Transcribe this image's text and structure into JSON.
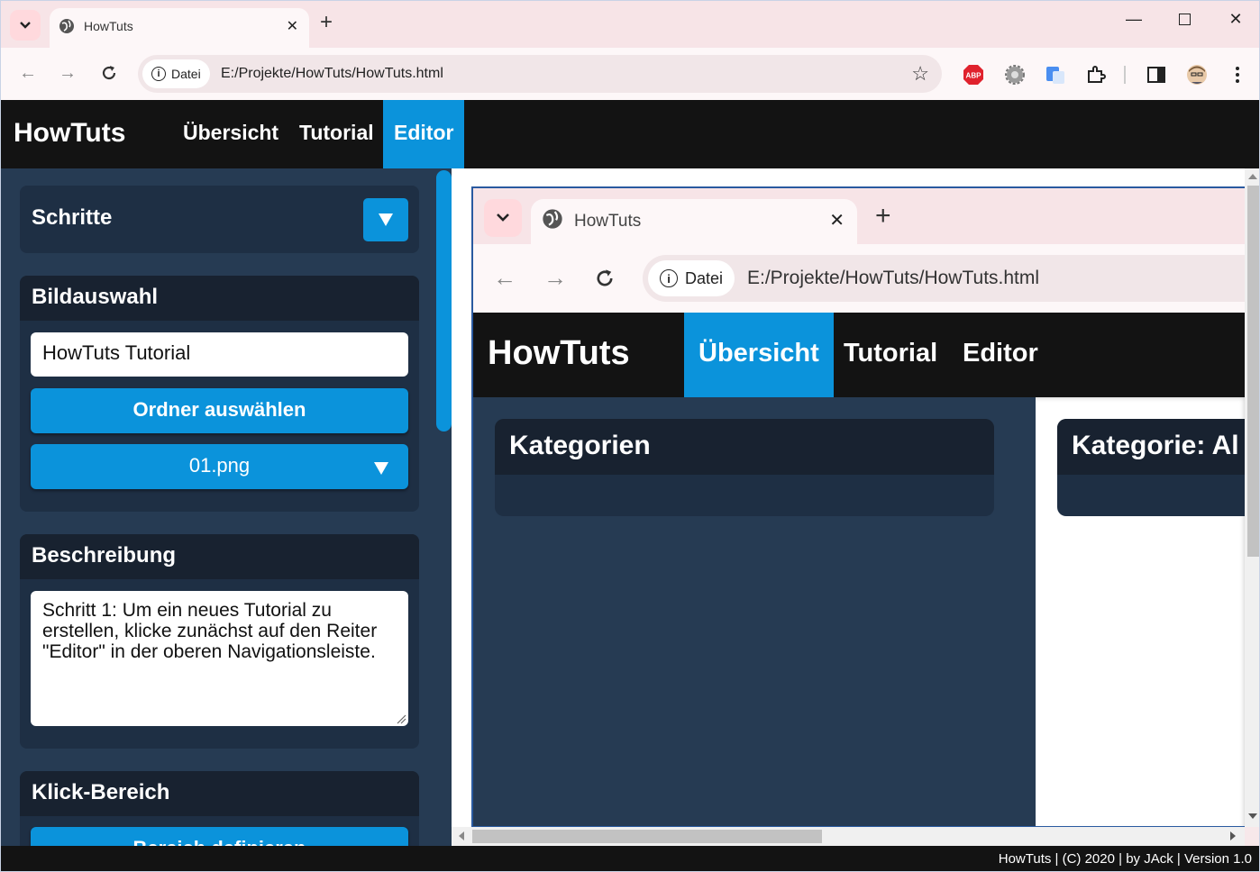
{
  "browser": {
    "tab_title": "HowTuts",
    "address_chip": "Datei",
    "url": "E:/Projekte/HowTuts/HowTuts.html",
    "extension_adblock_label": "ABP"
  },
  "app": {
    "brand": "HowTuts",
    "nav": [
      {
        "label": "Übersicht",
        "active": false
      },
      {
        "label": "Tutorial",
        "active": false
      },
      {
        "label": "Editor",
        "active": true
      }
    ],
    "accent_color": "#0b93db",
    "nav_bg": "#131313",
    "panel_bg": "#263b53"
  },
  "sidebar": {
    "steps_title": "Schritte",
    "image_select": {
      "title": "Bildauswahl",
      "name_value": "HowTuts Tutorial",
      "folder_button": "Ordner auswählen",
      "file_select_value": "01.png"
    },
    "description": {
      "title": "Beschreibung",
      "text": "Schritt 1: Um ein neues Tutorial zu erstellen, klicke zunächst auf den Reiter \"Editor\" in der oberen Navigationsleiste."
    },
    "click_area": {
      "title": "Klick-Bereich",
      "define_button": "Bereich definieren"
    }
  },
  "preview": {
    "tab_title": "HowTuts",
    "address_chip": "Datei",
    "url": "E:/Projekte/HowTuts/HowTuts.html",
    "brand": "HowTuts",
    "nav": [
      {
        "label": "Übersicht",
        "active": true
      },
      {
        "label": "Tutorial",
        "active": false
      },
      {
        "label": "Editor",
        "active": false
      }
    ],
    "categories_title": "Kategorien",
    "category_title": "Kategorie: Al"
  },
  "footer": {
    "text": "HowTuts | (C) 2020 | by JAck | Version 1.0"
  }
}
